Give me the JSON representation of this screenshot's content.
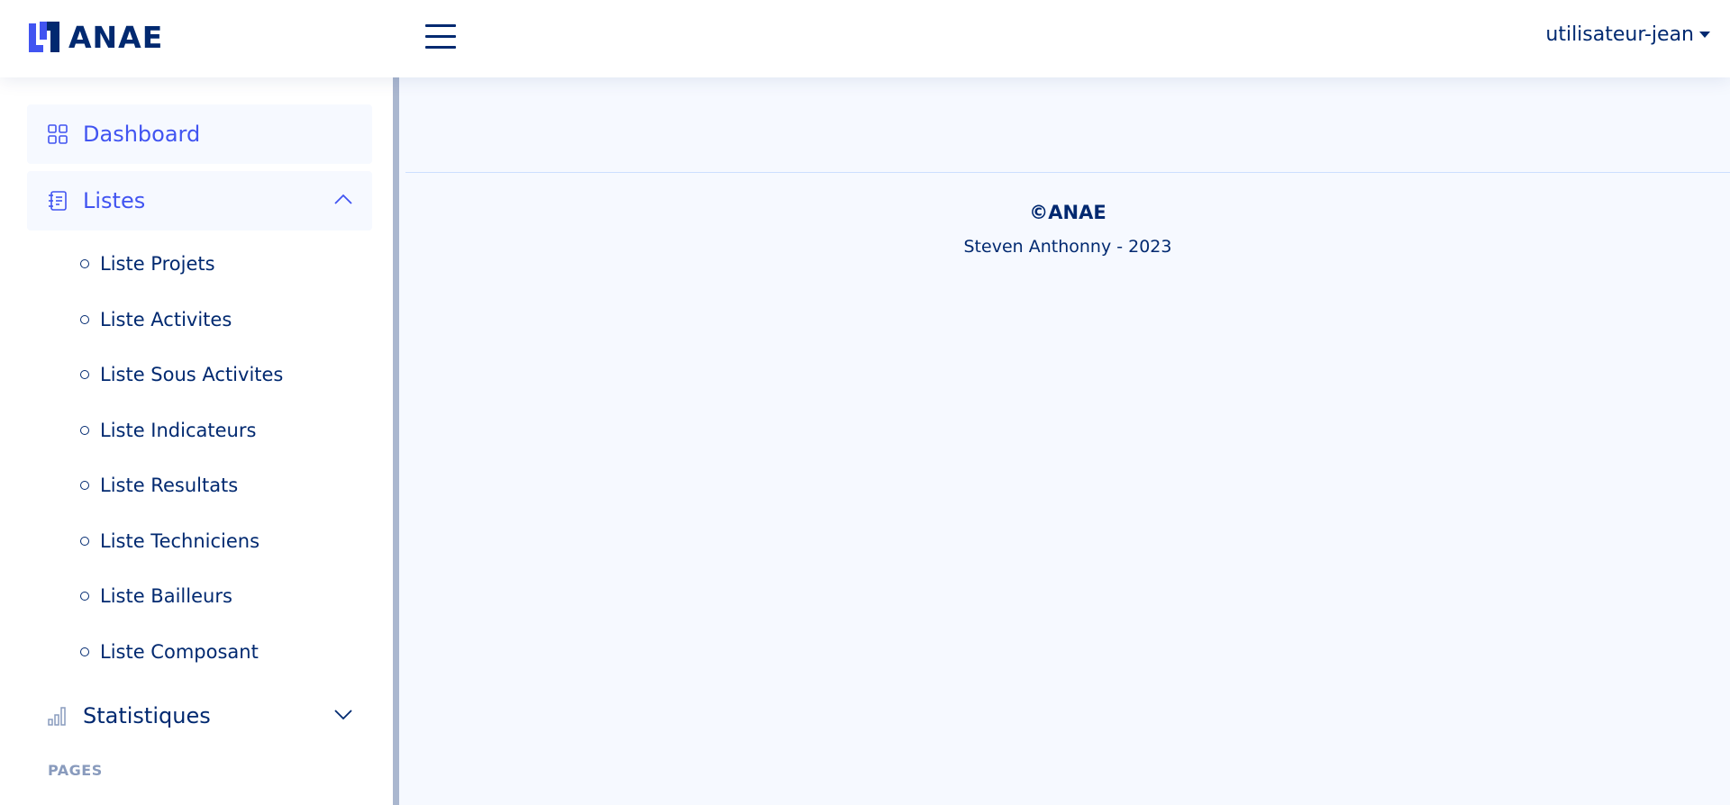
{
  "header": {
    "brand": "ANAE",
    "user": "utilisateur-jean"
  },
  "sidebar": {
    "dashboard_label": "Dashboard",
    "listes_label": "Listes",
    "listes_items": [
      "Liste Projets",
      "Liste Activites",
      "Liste Sous Activites",
      "Liste Indicateurs",
      "Liste Resultats",
      "Liste Techniciens",
      "Liste Bailleurs",
      "Liste Composant"
    ],
    "statistiques_label": "Statistiques",
    "pages_heading": "PAGES"
  },
  "footer": {
    "copyright": "©ANAE",
    "credit": "Steven Anthonny - 2023"
  },
  "colors": {
    "primary_text": "#012970",
    "accent": "#4154f1",
    "background": "#f6f9ff",
    "muted": "#899bbd"
  },
  "icons": {
    "logo": "anae-logo-icon",
    "menu": "hamburger-menu-icon",
    "user_caret": "caret-down-icon",
    "dashboard": "grid-icon",
    "listes": "journal-text-icon",
    "statistiques": "bar-chart-icon",
    "expanded": "chevron-up-icon",
    "collapsed": "chevron-down-icon",
    "sub_bullet": "circle-icon"
  }
}
